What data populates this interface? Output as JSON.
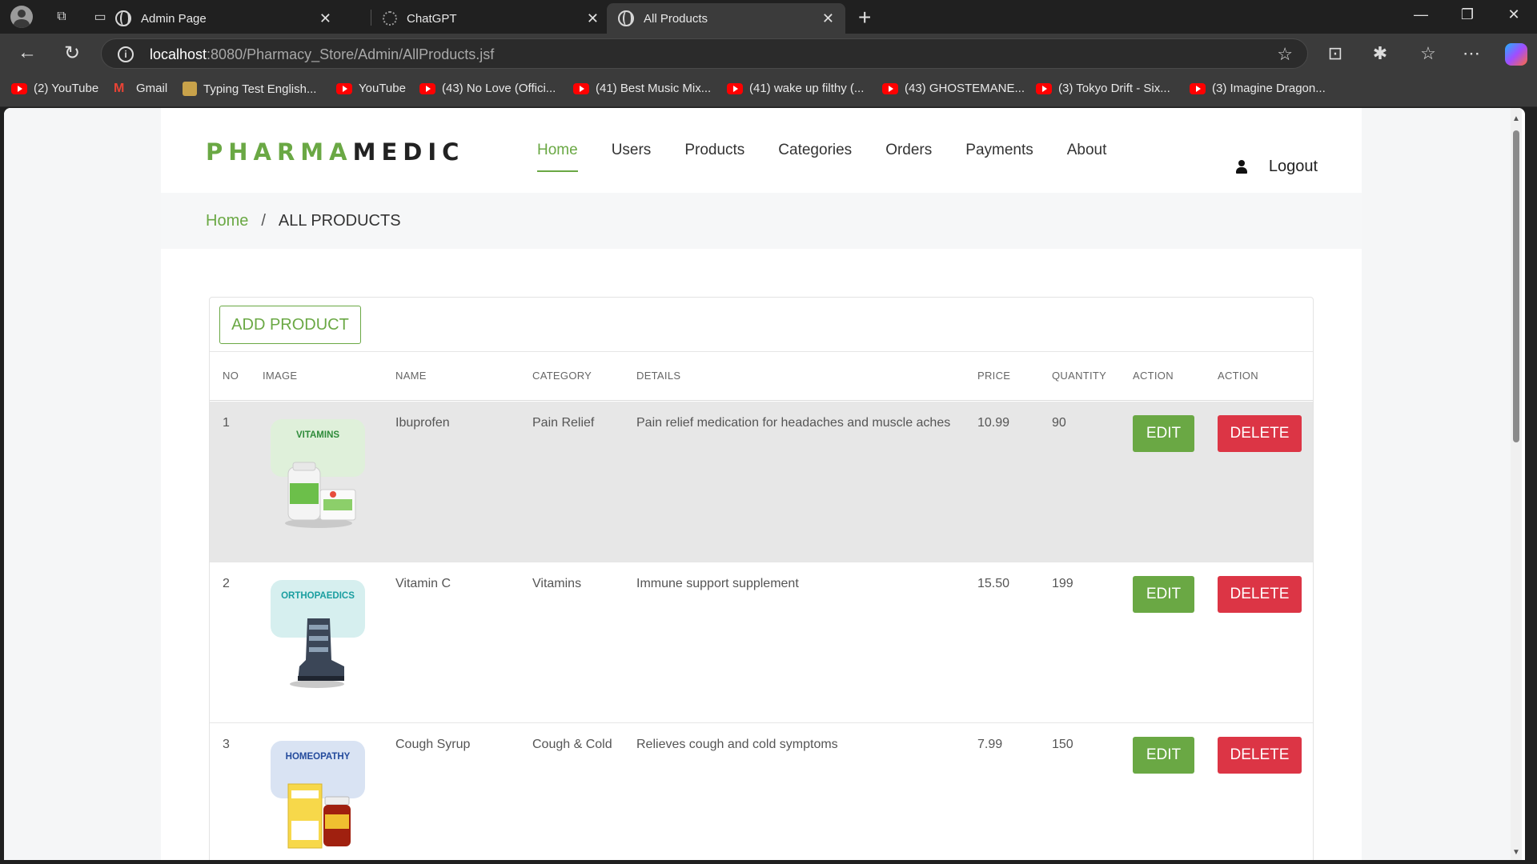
{
  "browser": {
    "tabs": [
      {
        "title": "Admin Page",
        "active": false
      },
      {
        "title": "ChatGPT",
        "active": false
      },
      {
        "title": "All Products",
        "active": true
      }
    ],
    "url_host": "localhost",
    "url_path": ":8080/Pharmacy_Store/Admin/AllProducts.jsf",
    "bookmarks": [
      {
        "label": "(2) YouTube",
        "icon": "youtube-icon"
      },
      {
        "label": "Gmail",
        "icon": "gmail-icon"
      },
      {
        "label": "Typing Test English...",
        "icon": "typing-test-icon"
      },
      {
        "label": "YouTube",
        "icon": "youtube-icon"
      },
      {
        "label": "(43) No Love (Offici...",
        "icon": "youtube-icon"
      },
      {
        "label": "(41) Best Music Mix...",
        "icon": "youtube-icon"
      },
      {
        "label": "(41) wake up filthy (...",
        "icon": "youtube-icon"
      },
      {
        "label": "(43) GHOSTEMANE...",
        "icon": "youtube-icon"
      },
      {
        "label": "(3) Tokyo Drift - Six...",
        "icon": "youtube-icon"
      },
      {
        "label": "(3) Imagine Dragon...",
        "icon": "youtube-icon"
      }
    ]
  },
  "site": {
    "logo_part1": "PHARMA",
    "logo_part2": "MEDIC",
    "nav": [
      "Home",
      "Users",
      "Products",
      "Categories",
      "Orders",
      "Payments",
      "About"
    ],
    "active_nav": "Home",
    "logout": "Logout",
    "breadcrumb_home": "Home",
    "breadcrumb_sep": "/",
    "breadcrumb_current": "ALL PRODUCTS"
  },
  "table": {
    "add_button": "ADD PRODUCT",
    "headers": [
      "NO",
      "IMAGE",
      "NAME",
      "CATEGORY",
      "DETAILS",
      "PRICE",
      "QUANTITY",
      "ACTION",
      "ACTION"
    ],
    "rows": [
      {
        "no": "1",
        "image_label": "VITAMINS",
        "name": "Ibuprofen",
        "category": "Pain Relief",
        "details": "Pain relief medication for headaches and muscle aches",
        "price": "10.99",
        "quantity": "90",
        "edit": "EDIT",
        "delete": "DELETE"
      },
      {
        "no": "2",
        "image_label": "ORTHOPAEDICS",
        "name": "Vitamin C",
        "category": "Vitamins",
        "details": "Immune support supplement",
        "price": "15.50",
        "quantity": "199",
        "edit": "EDIT",
        "delete": "DELETE"
      },
      {
        "no": "3",
        "image_label": "HOMEOPATHY",
        "name": "Cough Syrup",
        "category": "Cough & Cold",
        "details": "Relieves cough and cold symptoms",
        "price": "7.99",
        "quantity": "150",
        "edit": "EDIT",
        "delete": "DELETE"
      }
    ]
  },
  "colors": {
    "accent_green": "#6aa844",
    "danger_red": "#dc3545",
    "vitamins_label": "#2e8b3a",
    "ortho_label": "#1a9ea0",
    "homeo_label": "#234a9c"
  }
}
